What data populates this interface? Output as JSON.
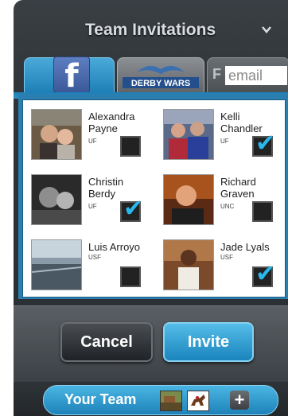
{
  "header": {
    "title": "Team Invitations",
    "collapse_icon": "chevron-down-icon"
  },
  "tabs": [
    {
      "label": "f",
      "icon": "facebook-icon",
      "active": true
    },
    {
      "label": "DERBY WARS",
      "icon": "derby-wars-logo"
    },
    {
      "label": "F",
      "field_text": "email"
    }
  ],
  "friends": [
    {
      "first": "Alexandra",
      "last": "Payne",
      "school": "UF",
      "checked": false
    },
    {
      "first": "Kelli",
      "last": "Chandler",
      "school": "UF",
      "checked": true
    },
    {
      "first": "Christin",
      "last": "Berdy",
      "school": "UF",
      "checked": true
    },
    {
      "first": "Richard",
      "last": "Graven",
      "school": "UNC",
      "checked": false
    },
    {
      "first": "Luis Arroyo",
      "last": "",
      "school": "USF",
      "checked": false
    },
    {
      "first": "Jade Lyals",
      "last": "",
      "school": "USF",
      "checked": true
    }
  ],
  "actions": {
    "cancel": "Cancel",
    "invite": "Invite"
  },
  "footer": {
    "your_team": "Your Team",
    "add": "+"
  },
  "colors": {
    "accent": "#1e82b9",
    "check": "#2bb7ea",
    "panel": "#2d3236"
  }
}
